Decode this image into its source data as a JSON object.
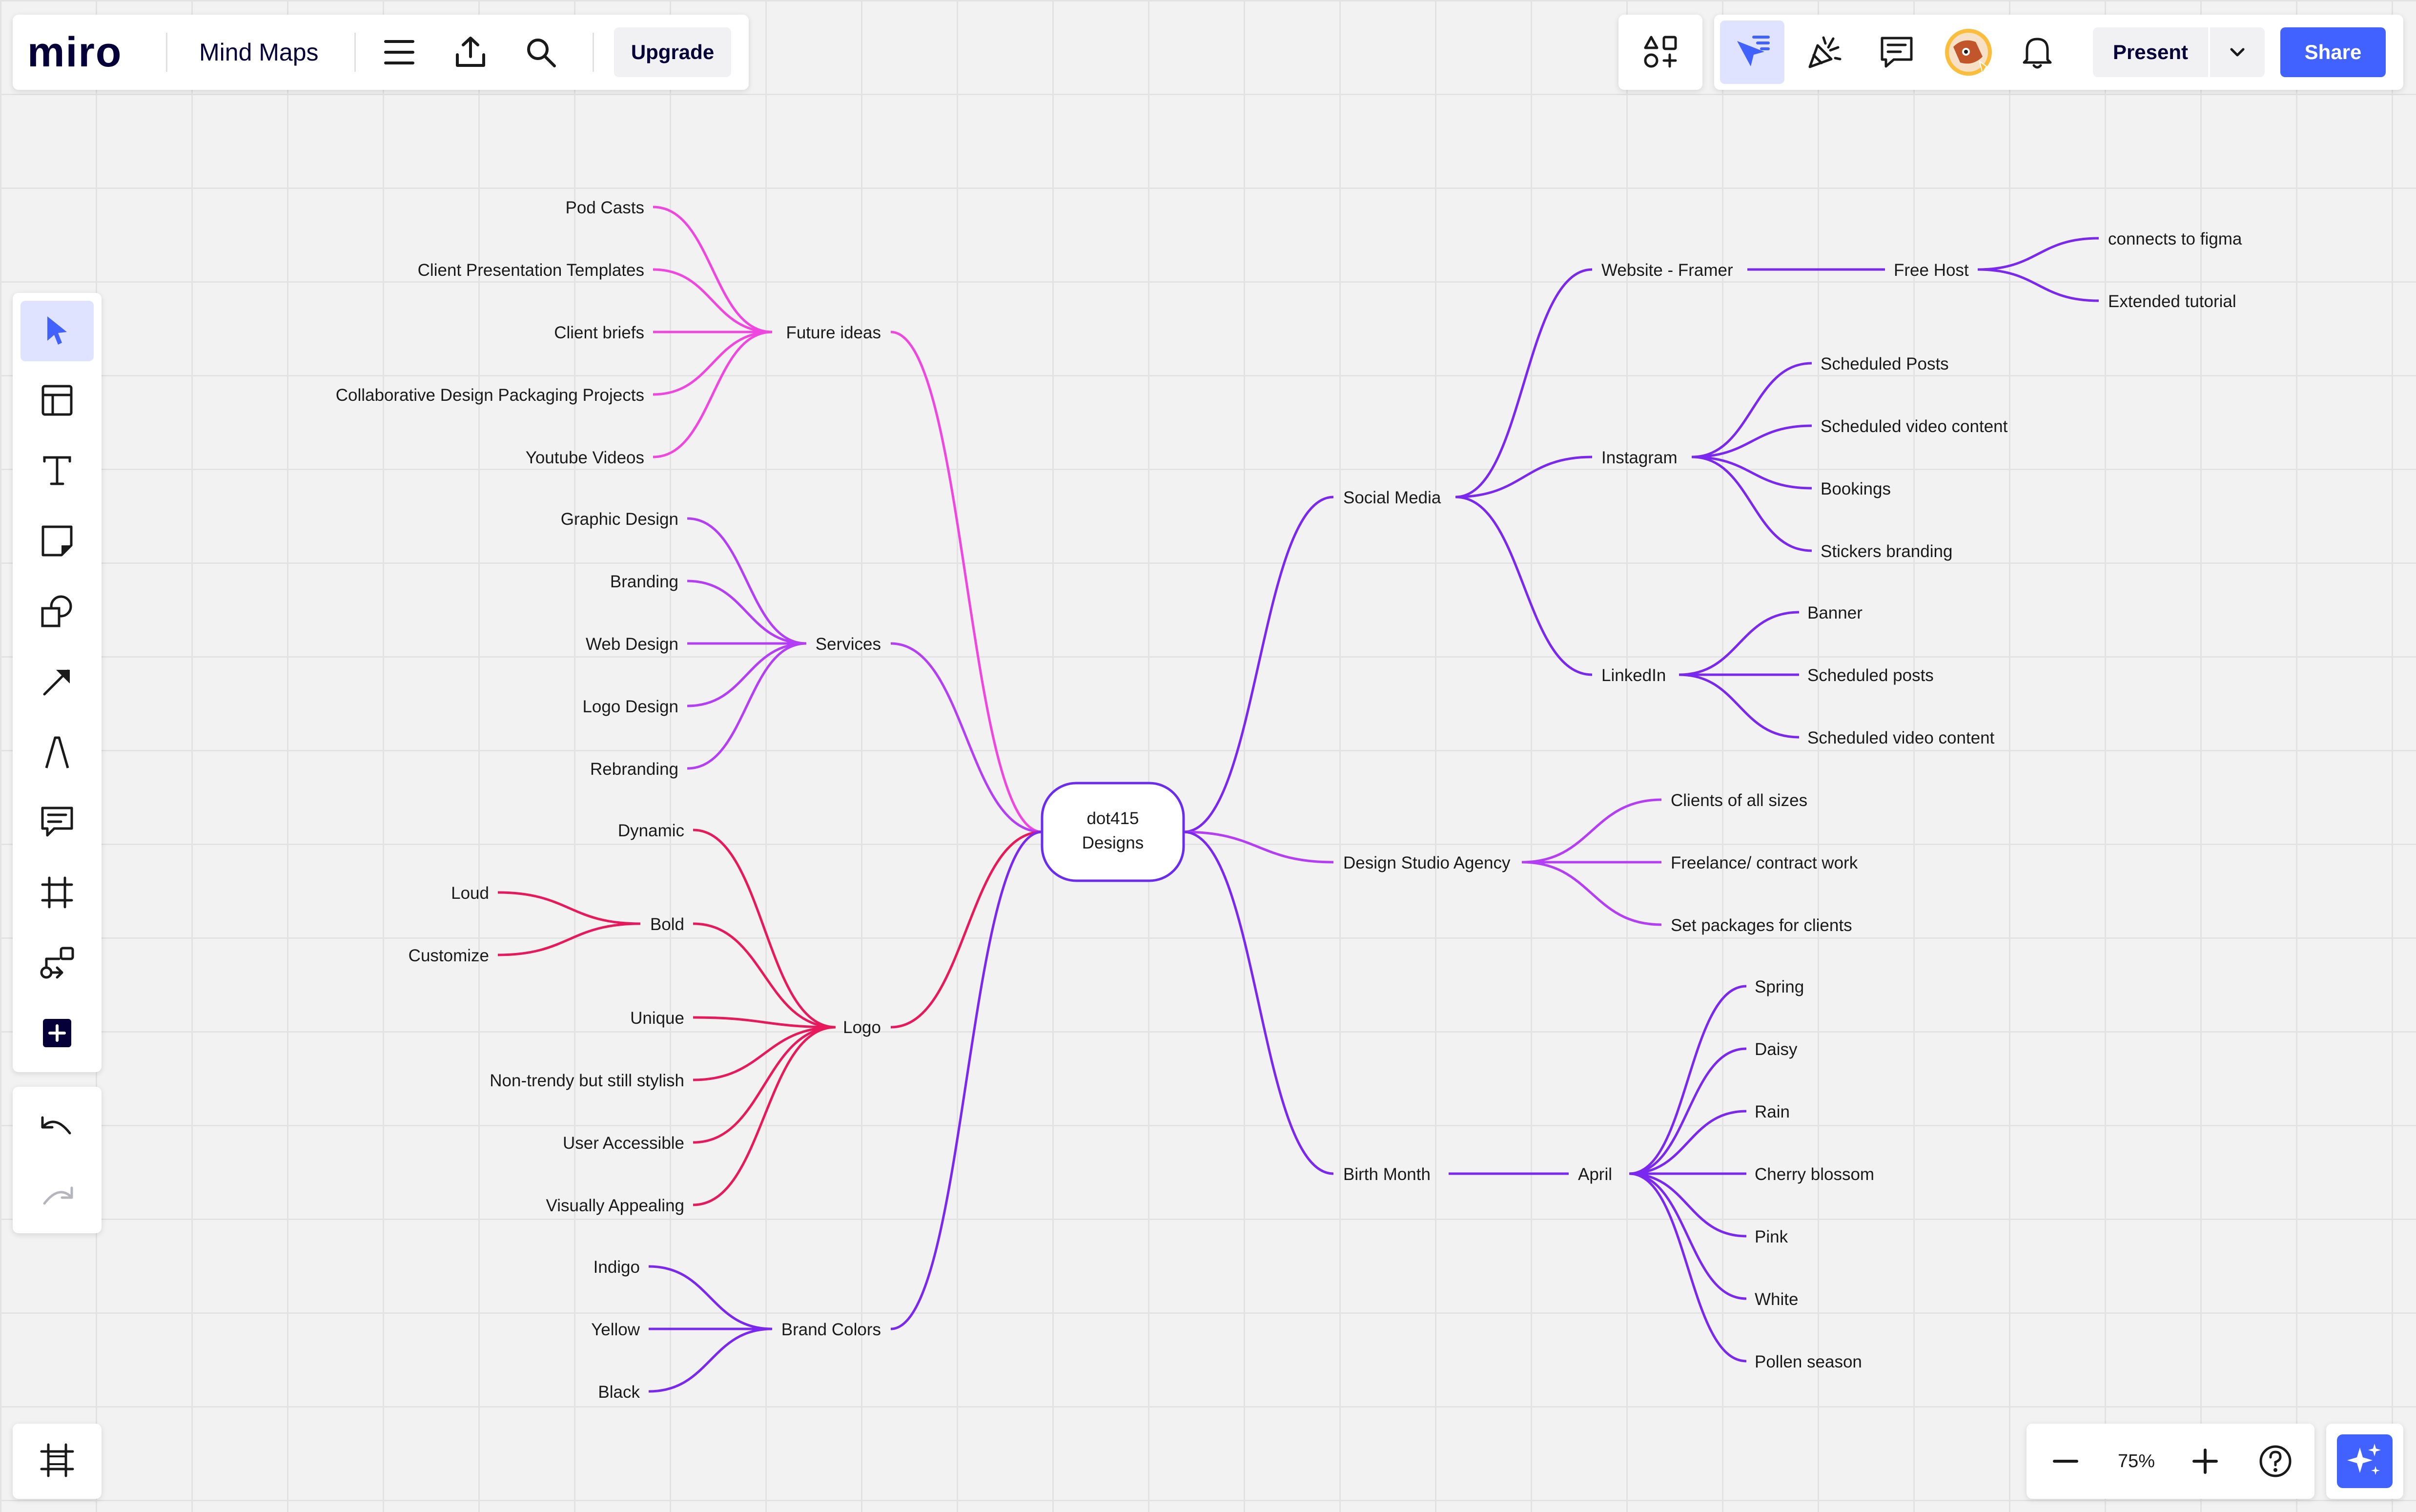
{
  "topbar": {
    "logo": "miro",
    "board_title": "Mind Maps",
    "upgrade_label": "Upgrade",
    "icons": [
      "menu-icon",
      "export-icon",
      "search-icon"
    ]
  },
  "right_toolbar": {
    "present_label": "Present",
    "share_label": "Share",
    "icons": [
      "apps-icon",
      "cursor-flag-icon",
      "celebrate-icon",
      "comments-icon",
      "avatar",
      "bell-icon",
      "chevron-down-icon"
    ]
  },
  "left_toolbar": {
    "tools": [
      "select-icon",
      "templates-icon",
      "text-icon",
      "sticky-note-icon",
      "shapes-icon",
      "connection-line-icon",
      "pen-icon",
      "comment-icon",
      "frame-icon",
      "mind-map-icon",
      "more-tools-icon"
    ],
    "undo_icon": "undo-icon",
    "redo_icon": "redo-icon"
  },
  "bottom_right": {
    "zoom_level": "75%",
    "icons": [
      "zoom-out-icon",
      "zoom-in-icon",
      "help-icon",
      "ai-sparkle-icon"
    ]
  },
  "bottom_left": {
    "icon": "frames-panel-icon"
  },
  "colors": {
    "accent": "#4262ff",
    "pink": "#f046e0",
    "magenta": "#b43ef5",
    "red": "#e8185c",
    "purple": "#7a28f0",
    "violet": "#6a2cf0"
  },
  "mindmap": {
    "center": [
      "dot415",
      "Designs"
    ],
    "future_ideas": {
      "label": "Future ideas",
      "children": [
        "Pod Casts",
        "Client Presentation Templates",
        "Client briefs",
        "Collaborative Design Packaging Projects",
        "Youtube Videos"
      ]
    },
    "services": {
      "label": "Services",
      "children": [
        "Graphic Design",
        "Branding",
        "Web Design",
        "Logo Design",
        "Rebranding"
      ]
    },
    "logo": {
      "label": "Logo",
      "dynamic": "Dynamic",
      "bold": {
        "label": "Bold",
        "children": [
          "Loud",
          "Customize"
        ]
      },
      "children": [
        "Unique",
        "Non-trendy but still stylish",
        "User Accessible",
        "Visually Appealing"
      ]
    },
    "brand_colors": {
      "label": "Brand Colors",
      "children": [
        "Indigo",
        "Yellow",
        "Black"
      ]
    },
    "social_media": {
      "label": "Social Media",
      "website": {
        "label": "Website - Framer",
        "free_host": {
          "label": "Free Host",
          "children": [
            "connects to figma",
            "Extended tutorial"
          ]
        }
      },
      "instagram": {
        "label": "Instagram",
        "children": [
          "Scheduled Posts",
          "Scheduled video content",
          "Bookings",
          "Stickers branding"
        ]
      },
      "linkedin": {
        "label": "LinkedIn",
        "children": [
          "Banner",
          "Scheduled posts",
          "Scheduled video content"
        ]
      }
    },
    "design_studio": {
      "label": "Design Studio Agency",
      "children": [
        "Clients of all sizes",
        "Freelance/ contract work",
        "Set packages for clients"
      ]
    },
    "birth_month": {
      "label": "Birth Month",
      "april": {
        "label": "April",
        "children": [
          "Spring",
          "Daisy",
          "Rain",
          "Cherry blossom",
          "Pink",
          "White",
          "Pollen season"
        ]
      }
    }
  }
}
